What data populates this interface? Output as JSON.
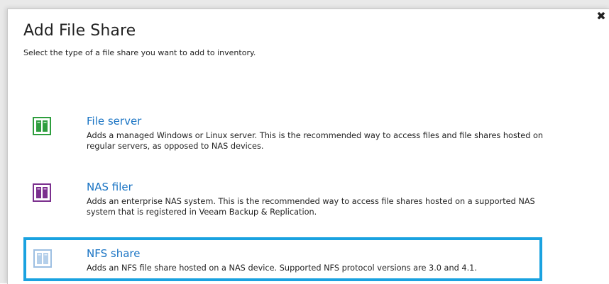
{
  "dialog": {
    "title": "Add File Share",
    "subtitle": "Select the type of a file share you want to add to inventory.",
    "close_label": "✖"
  },
  "options": [
    {
      "name": "File server",
      "description_lines": [
        "Adds a managed Windows or Linux server. This is the recommended way to access files and file shares hosted on",
        "regular servers, as opposed to NAS devices."
      ],
      "icon": "file-server-icon",
      "icon_color": "#2e9e3e",
      "selected": false
    },
    {
      "name": "NAS filer",
      "description_lines": [
        "Adds an enterprise NAS system. This is the recommended way to access file shares hosted on a supported NAS",
        "system that is registered in Veeam Backup & Replication."
      ],
      "icon": "nas-filer-icon",
      "icon_color": "#7b2f8e",
      "selected": false
    },
    {
      "name": "NFS share",
      "description_lines": [
        "Adds an NFS file share hosted on a NAS device. Supported NFS protocol versions are 3.0 and 4.1."
      ],
      "icon": "nfs-share-icon",
      "icon_color": "#8fb3d9",
      "selected": true
    }
  ],
  "colors": {
    "link": "#1a74c4",
    "selection_border": "#1aa2e0"
  }
}
